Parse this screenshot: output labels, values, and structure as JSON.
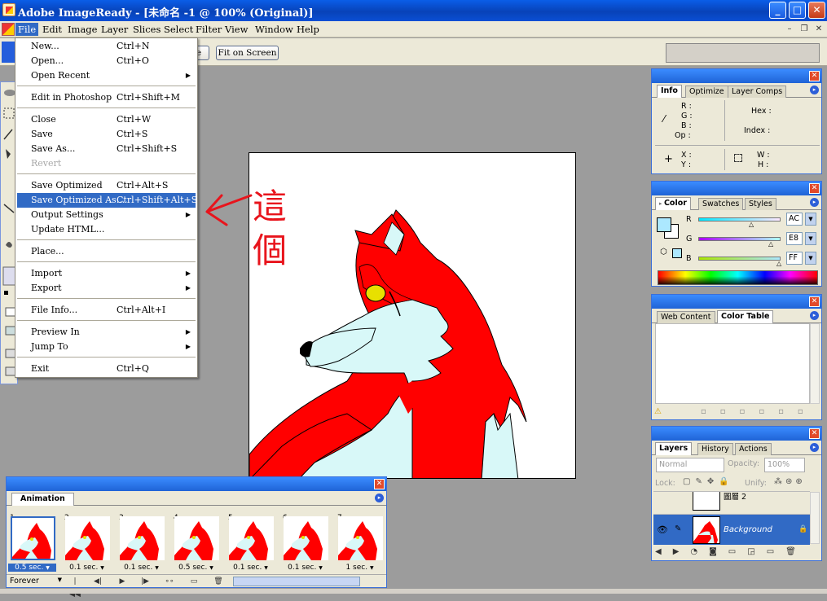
{
  "window": {
    "title": "Adobe ImageReady - [未命名 -1 @ 100% (Original)]"
  },
  "menubar": {
    "items": [
      "File",
      "Edit",
      "Image",
      "Layer",
      "Slices",
      "Select",
      "Filter",
      "View",
      "Window",
      "Help"
    ],
    "active": "File"
  },
  "options_bar": {
    "partial_button": "e",
    "fit_on_screen": "Fit on Screen"
  },
  "file_menu": {
    "items": [
      {
        "label": "New...",
        "shortcut": "Ctrl+N"
      },
      {
        "label": "Open...",
        "shortcut": "Ctrl+O"
      },
      {
        "label": "Open Recent",
        "shortcut": "",
        "submenu": true
      },
      {
        "label": "Edit in Photoshop",
        "shortcut": "Ctrl+Shift+M"
      },
      {
        "label": "Close",
        "shortcut": "Ctrl+W"
      },
      {
        "label": "Save",
        "shortcut": "Ctrl+S"
      },
      {
        "label": "Save As...",
        "shortcut": "Ctrl+Shift+S"
      },
      {
        "label": "Revert",
        "shortcut": "",
        "disabled": true
      },
      {
        "label": "Save Optimized",
        "shortcut": "Ctrl+Alt+S"
      },
      {
        "label": "Save Optimized As...",
        "shortcut": "Ctrl+Shift+Alt+S",
        "highlighted": true
      },
      {
        "label": "Output Settings",
        "shortcut": "",
        "submenu": true
      },
      {
        "label": "Update HTML...",
        "shortcut": ""
      },
      {
        "label": "Place...",
        "shortcut": ""
      },
      {
        "label": "Import",
        "shortcut": "",
        "submenu": true
      },
      {
        "label": "Export",
        "shortcut": "",
        "submenu": true
      },
      {
        "label": "File Info...",
        "shortcut": "Ctrl+Alt+I"
      },
      {
        "label": "Preview In",
        "shortcut": "",
        "submenu": true
      },
      {
        "label": "Jump To",
        "shortcut": "",
        "submenu": true
      },
      {
        "label": "Exit",
        "shortcut": "Ctrl+Q"
      }
    ]
  },
  "annotation": {
    "text": "這個",
    "color": "#e8141c"
  },
  "info_panel": {
    "tabs": [
      "Info",
      "Optimize",
      "Layer Comps"
    ],
    "active_tab": "Info",
    "labels": {
      "r": "R :",
      "g": "G :",
      "b": "B :",
      "op": "Op :",
      "hex": "Hex :",
      "index": "Index :",
      "x": "X :",
      "y": "Y :",
      "w": "W :",
      "h": "H :"
    }
  },
  "color_panel": {
    "tabs": [
      "Color",
      "Swatches",
      "Styles"
    ],
    "active_tab": "Color",
    "channels": [
      {
        "name": "R",
        "value": "AC"
      },
      {
        "name": "G",
        "value": "E8"
      },
      {
        "name": "B",
        "value": "FF"
      }
    ],
    "foreground": "#ace8ff"
  },
  "color_table_panel": {
    "tabs": [
      "Web Content",
      "Color Table"
    ],
    "active_tab": "Color Table"
  },
  "layers_panel": {
    "tabs": [
      "Layers",
      "History",
      "Actions"
    ],
    "active_tab": "Layers",
    "blend_mode": "Normal",
    "opacity_label": "Opacity:",
    "opacity_value": "100%",
    "lock_label": "Lock:",
    "unify_label": "Unify:",
    "layers": [
      {
        "name": "圖層 2",
        "selected": false
      },
      {
        "name": "Background",
        "selected": true
      }
    ]
  },
  "animation_panel": {
    "tab": "Animation",
    "loop": "Forever",
    "frames": [
      {
        "num": "1",
        "delay": "0.5 sec.",
        "selected": true
      },
      {
        "num": "2",
        "delay": "0.1 sec.",
        "selected": false
      },
      {
        "num": "3",
        "delay": "0.1 sec.",
        "selected": false
      },
      {
        "num": "4",
        "delay": "0.5 sec.",
        "selected": false
      },
      {
        "num": "5",
        "delay": "0.1 sec.",
        "selected": false
      },
      {
        "num": "6",
        "delay": "0.1 sec.",
        "selected": false
      },
      {
        "num": "7",
        "delay": "1 sec.",
        "selected": false
      }
    ]
  },
  "colors": {
    "wolf_red": "#ff0000",
    "wolf_light": "#d8f8f8",
    "eye": "#e8e000",
    "highlight": "#316ac5"
  }
}
